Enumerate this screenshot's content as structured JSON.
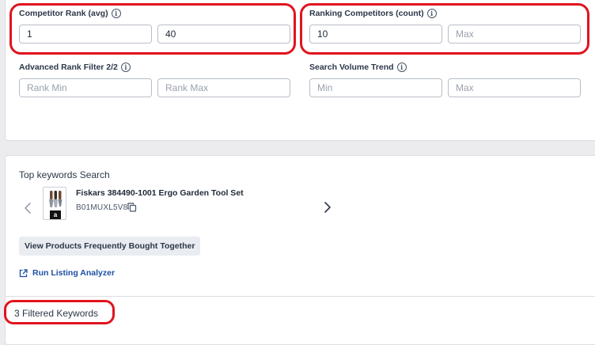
{
  "filters": {
    "competitor_rank": {
      "label": "Competitor Rank (avg)",
      "min_value": "1",
      "max_value": "40"
    },
    "ranking_competitors": {
      "label": "Ranking Competitors (count)",
      "min_value": "10",
      "max_placeholder": "Max"
    },
    "advanced_rank": {
      "label": "Advanced Rank Filter 2/2",
      "min_placeholder": "Rank Min",
      "max_placeholder": "Rank Max"
    },
    "search_volume_trend": {
      "label": "Search Volume Trend",
      "min_placeholder": "Min",
      "max_placeholder": "Max"
    }
  },
  "product_section": {
    "heading": "Top keywords Search",
    "product_title": "Fiskars 384490-1001 Ergo Garden Tool Set",
    "asin": "B01MUXL5V8",
    "marketplace_badge": "a",
    "frequently_bought_button": "View Products Frequently Bought Together",
    "listing_analyzer_link": "Run Listing Analyzer"
  },
  "results": {
    "filtered_keywords": "3 Filtered Keywords"
  },
  "colors": {
    "highlight": "#e0141e",
    "link": "#1e4fa3",
    "button_bg": "#e9ecf1"
  }
}
